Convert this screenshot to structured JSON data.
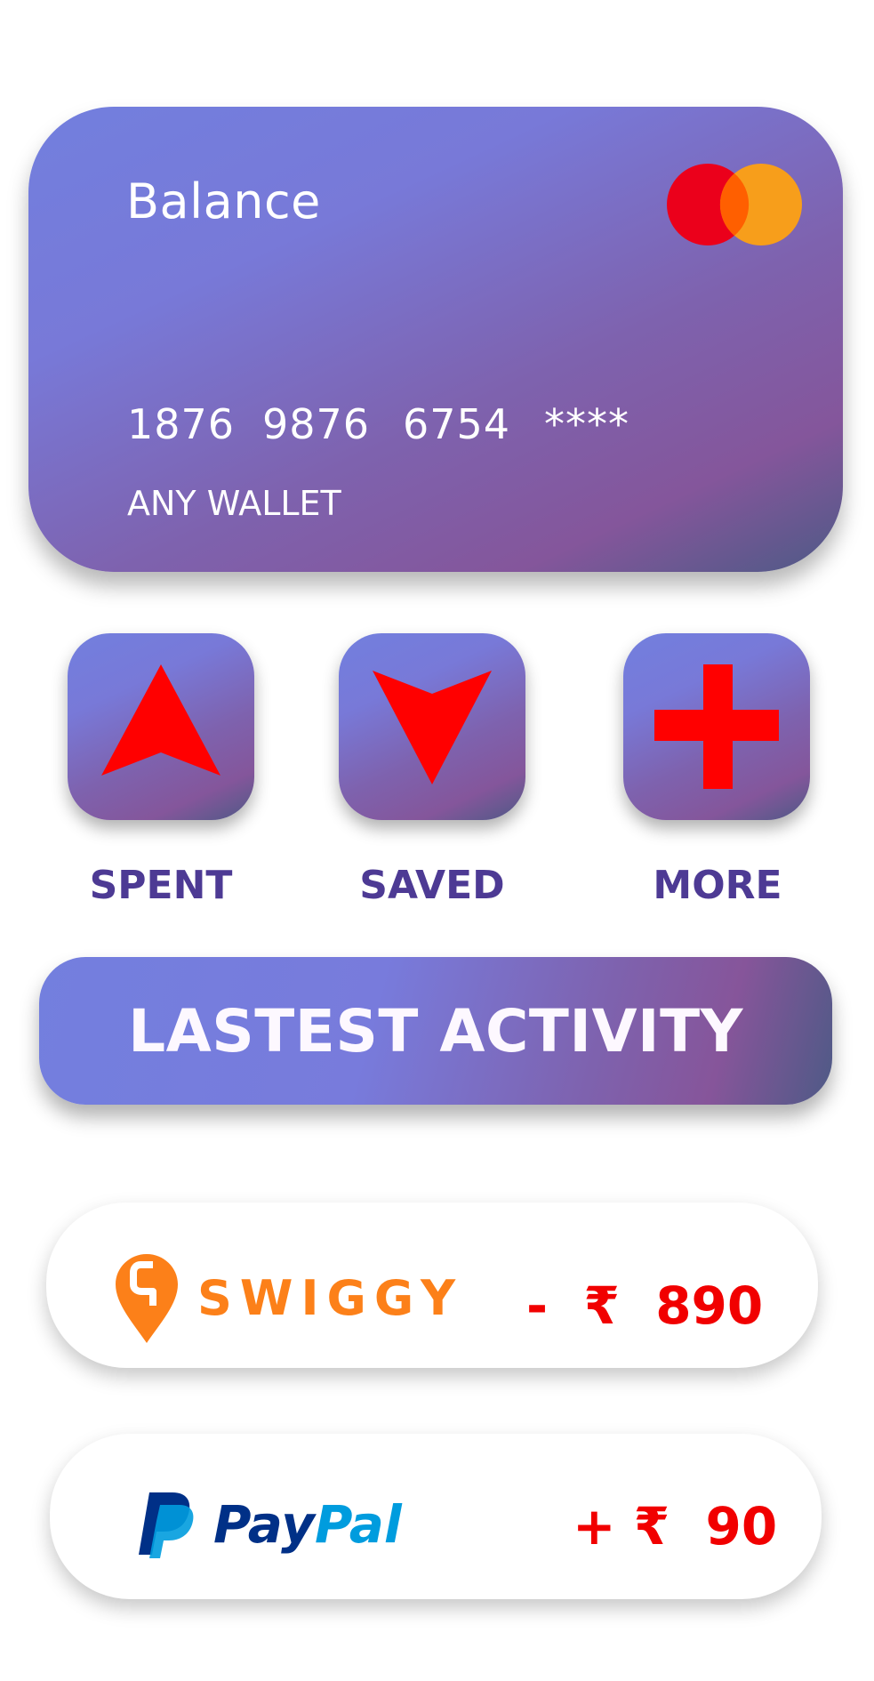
{
  "card": {
    "title": "Balance",
    "number_groups": [
      "1876",
      "9876",
      "6754",
      "****"
    ],
    "holder": "ANY WALLET",
    "logo_icon": "mastercard-logo",
    "logo_colors": {
      "left": "#eb001b",
      "right": "#f79e1b",
      "overlap": "#ff5f00"
    }
  },
  "actions": [
    {
      "label": "SPENT",
      "icon": "arrow-up-icon"
    },
    {
      "label": "SAVED",
      "icon": "arrow-down-icon"
    },
    {
      "label": "MORE",
      "icon": "plus-icon"
    }
  ],
  "activity": {
    "title": "LASTEST ACTIVITY",
    "transactions": [
      {
        "merchant": "SWIGGY",
        "logo_icon": "swiggy-logo",
        "amount": "-  ₹  890",
        "logo_color": "#fc8019"
      },
      {
        "merchant": "PayPal",
        "logo_icon": "paypal-logo",
        "amount": "+ ₹  90",
        "logo_colors": [
          "#003087",
          "#009cde"
        ]
      }
    ]
  },
  "colors": {
    "accent_text": "#4d3a94",
    "icon_red": "#ff0000",
    "amount_red": "#f10000"
  }
}
